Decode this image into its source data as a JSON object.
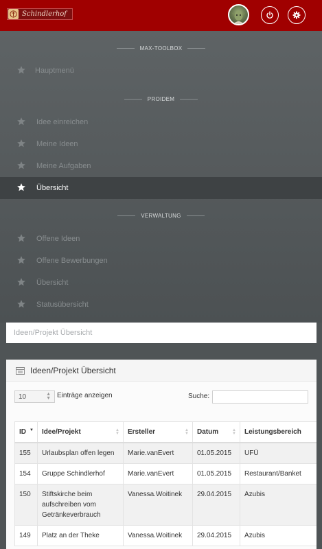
{
  "header": {
    "logo_text": "Schindlerhof",
    "brand_color": "#a00000",
    "icons": [
      "user-avatar",
      "power-icon",
      "gear-icon"
    ]
  },
  "menu": {
    "sections": [
      {
        "heading": "MAX-TOOLBOX",
        "items": [
          {
            "label": "Hauptmenü",
            "active": false
          }
        ]
      },
      {
        "heading": "PROIDEM",
        "items": [
          {
            "label": "Idee einreichen",
            "active": false
          },
          {
            "label": "Meine Ideen",
            "active": false
          },
          {
            "label": "Meine Aufgaben",
            "active": false
          },
          {
            "label": "Übersicht",
            "active": true
          }
        ]
      },
      {
        "heading": "VERWALTUNG",
        "items": [
          {
            "label": "Offene Ideen",
            "active": false
          },
          {
            "label": "Offene Bewerbungen",
            "active": false
          },
          {
            "label": "Übersicht",
            "active": false
          },
          {
            "label": "Statusübersicht",
            "active": false
          }
        ]
      }
    ]
  },
  "breadcrumb": "Ideen/Projekt Übersicht",
  "panel": {
    "title": "Ideen/Projekt Übersicht",
    "length_value": "10",
    "length_label": "Einträge anzeigen",
    "search_label": "Suche:",
    "search_value": ""
  },
  "table": {
    "columns": [
      "ID",
      "Idee/Projekt",
      "Ersteller",
      "Datum",
      "Leistungsbereich"
    ],
    "sorted_column": "ID",
    "rows": [
      {
        "id": "155",
        "idee": "Urlaubsplan offen legen",
        "ersteller": "Marie.vanEvert",
        "datum": "01.05.2015",
        "bereich": "UFÜ"
      },
      {
        "id": "154",
        "idee": "Gruppe Schindlerhof",
        "ersteller": "Marie.vanEvert",
        "datum": "01.05.2015",
        "bereich": "Restaurant/Banket"
      },
      {
        "id": "150",
        "idee": "Stiftskirche beim aufschreiben vom Getränkeverbrauch",
        "ersteller": "Vanessa.Woitinek",
        "datum": "29.04.2015",
        "bereich": "Azubis"
      },
      {
        "id": "149",
        "idee": "Platz an der Theke",
        "ersteller": "Vanessa.Woitinek",
        "datum": "29.04.2015",
        "bereich": "Azubis"
      }
    ]
  }
}
